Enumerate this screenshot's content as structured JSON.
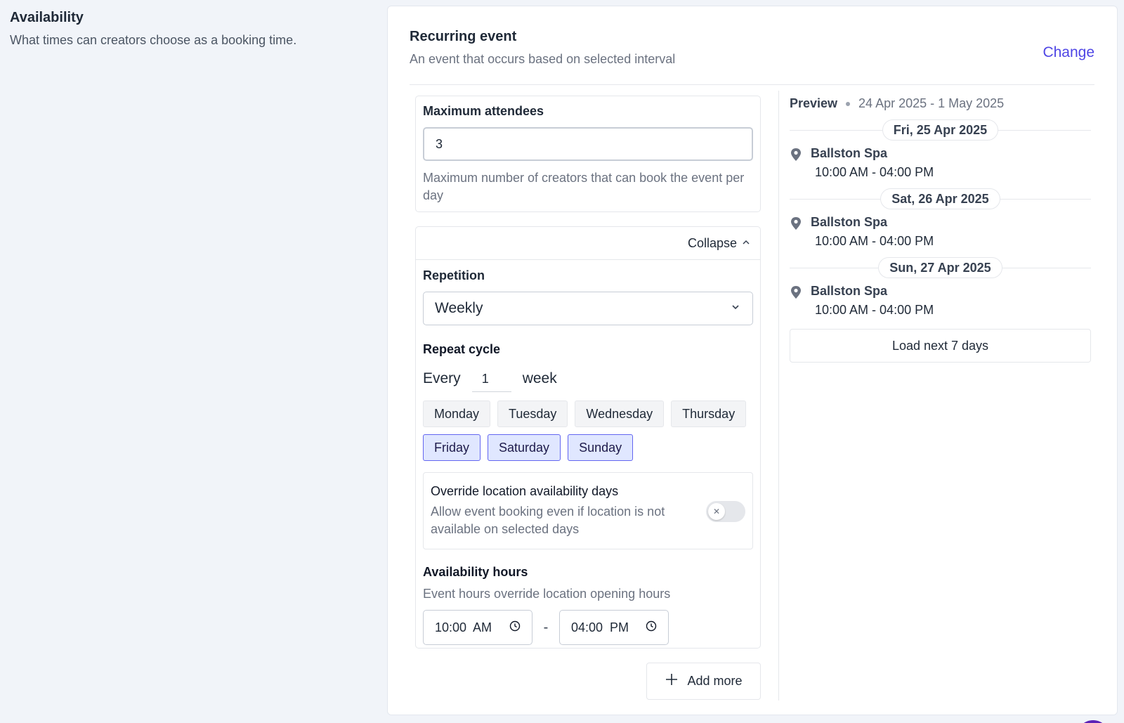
{
  "section": {
    "title": "Availability",
    "description": "What times can creators choose as a booking time."
  },
  "card": {
    "title": "Recurring event",
    "subtitle": "An event that occurs based on selected interval",
    "change_label": "Change"
  },
  "attendees": {
    "label": "Maximum attendees",
    "value": "3",
    "hint": "Maximum number of creators that can book the event per day"
  },
  "repetition": {
    "collapse_label": "Collapse",
    "label": "Repetition",
    "selected": "Weekly",
    "repeat_cycle_label": "Repeat cycle",
    "every_label": "Every",
    "every_value": "1",
    "unit_label": "week",
    "days": [
      {
        "label": "Monday",
        "selected": false
      },
      {
        "label": "Tuesday",
        "selected": false
      },
      {
        "label": "Wednesday",
        "selected": false
      },
      {
        "label": "Thursday",
        "selected": false
      },
      {
        "label": "Friday",
        "selected": true
      },
      {
        "label": "Saturday",
        "selected": true
      },
      {
        "label": "Sunday",
        "selected": true
      }
    ],
    "override": {
      "title": "Override location availability days",
      "description": "Allow event booking even if location is not available on selected days",
      "enabled": false
    },
    "hours": {
      "label": "Availability hours",
      "description": "Event hours override location opening hours",
      "start": "10:00  AM",
      "separator": "-",
      "end": "04:00  PM"
    }
  },
  "add_more_label": "Add more",
  "preview": {
    "label": "Preview",
    "range": "24 Apr 2025 - 1 May 2025",
    "groups": [
      {
        "date": "Fri, 25 Apr 2025",
        "location": "Ballston Spa",
        "time": "10:00 AM - 04:00 PM"
      },
      {
        "date": "Sat, 26 Apr 2025",
        "location": "Ballston Spa",
        "time": "10:00 AM - 04:00 PM"
      },
      {
        "date": "Sun, 27 Apr 2025",
        "location": "Ballston Spa",
        "time": "10:00 AM - 04:00 PM"
      }
    ],
    "load_more_label": "Load next 7 days"
  },
  "colors": {
    "accent": "#4f46e5",
    "selected_day_bg": "#e0e7ff",
    "selected_day_border": "#6366f1"
  }
}
